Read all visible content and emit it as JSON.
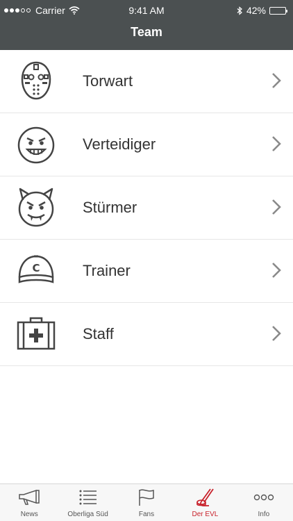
{
  "status": {
    "carrier": "Carrier",
    "time": "9:41 AM",
    "battery": "42%",
    "battery_level": 0.42
  },
  "nav": {
    "title": "Team"
  },
  "rows": [
    {
      "label": "Torwart",
      "icon": "goalie-mask-icon"
    },
    {
      "label": "Verteidiger",
      "icon": "grinning-face-icon"
    },
    {
      "label": "Stürmer",
      "icon": "devil-face-icon"
    },
    {
      "label": "Trainer",
      "icon": "cap-icon"
    },
    {
      "label": "Staff",
      "icon": "first-aid-kit-icon"
    }
  ],
  "tabs": [
    {
      "label": "News",
      "icon": "megaphone-icon",
      "active": false
    },
    {
      "label": "Oberliga Süd",
      "icon": "list-icon",
      "active": false
    },
    {
      "label": "Fans",
      "icon": "flag-icon",
      "active": false
    },
    {
      "label": "Der EVL",
      "icon": "hockey-stick-icon",
      "active": true
    },
    {
      "label": "Info",
      "icon": "more-icon",
      "active": false
    }
  ],
  "colors": {
    "header": "#4b5051",
    "accent": "#c8202a",
    "chevron": "#8a8a8a"
  }
}
